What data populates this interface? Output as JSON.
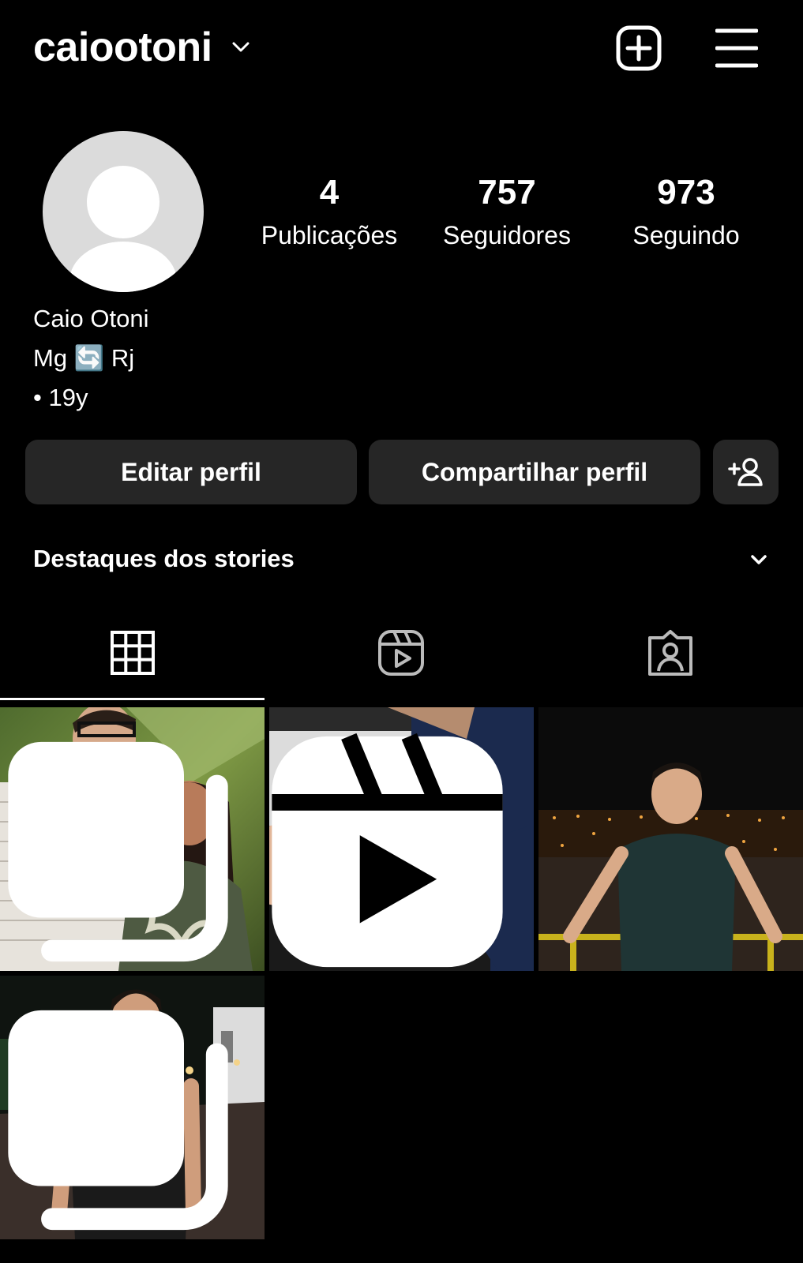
{
  "header": {
    "username": "caiootoni"
  },
  "profile": {
    "name": "Caio Otoni",
    "bio_line1": "Mg 🔄 Rj",
    "bio_line2": "• 19y",
    "stats": [
      {
        "value": "4",
        "label": "Publicações"
      },
      {
        "value": "757",
        "label": "Seguidores"
      },
      {
        "value": "973",
        "label": "Seguindo"
      }
    ]
  },
  "actions": {
    "edit_label": "Editar perfil",
    "share_label": "Compartilhar perfil"
  },
  "highlights": {
    "label": "Destaques dos stories"
  },
  "tabs": [
    {
      "icon": "grid-icon",
      "active": true
    },
    {
      "icon": "reels-icon",
      "active": false
    },
    {
      "icon": "tagged-icon",
      "active": false
    }
  ],
  "posts": [
    {
      "type": "carousel",
      "scene": "couple outdoors"
    },
    {
      "type": "reel",
      "scene": "massage treatment"
    },
    {
      "type": "photo",
      "scene": "night city view"
    },
    {
      "type": "carousel",
      "scene": "night street portrait"
    }
  ],
  "colors": {
    "background": "#000000",
    "button_bg": "#262626",
    "avatar_bg": "#dbdbdb"
  }
}
